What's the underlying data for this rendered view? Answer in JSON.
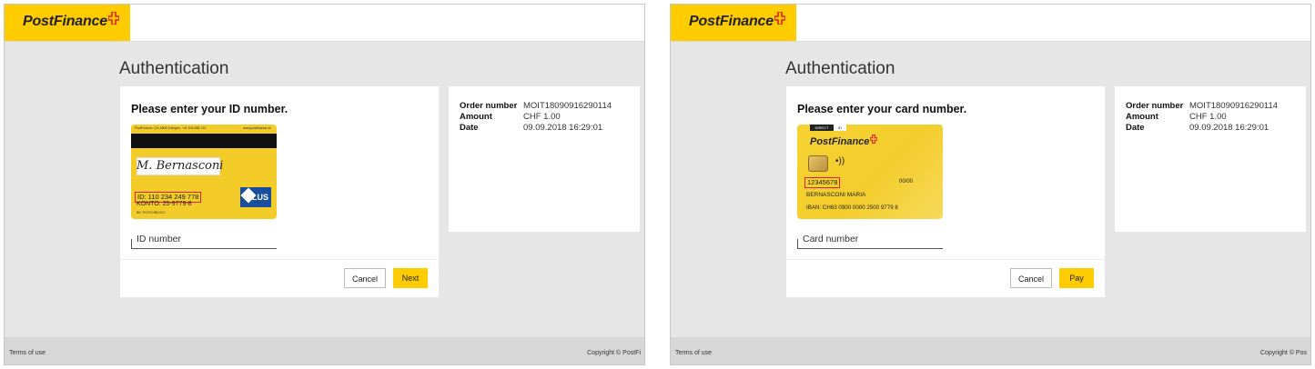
{
  "colors": {
    "brand_yellow": "#ffcc00",
    "highlight_red": "#e0201c",
    "background_gray": "#e6e6e6"
  },
  "panels": [
    {
      "brand": "PostFinance",
      "title": "Authentication",
      "prompt": "Please enter your ID number.",
      "card": {
        "header_left": "PostFinance, CH-4808 Zofingen, +41 848 888 710",
        "header_right": "www.postfinance.ch",
        "signature": "M. Bernasconi",
        "id_number": "ID: 110 234 249 778",
        "konto": "KONTO: 25-9779-8",
        "bic": "BIC POFICHBEXXX",
        "badge": "PLUS"
      },
      "field_label": "ID number",
      "cancel_label": "Cancel",
      "confirm_label": "Next",
      "order": {
        "order_number_label": "Order number",
        "order_number": "MOIT18090916290114",
        "amount_label": "Amount",
        "amount": "CHF  1.00",
        "date_label": "Date",
        "date": "09.09.2018 16:29:01"
      },
      "footer_left": "Terms of use",
      "footer_right": "Copyright © PostFi"
    },
    {
      "brand": "PostFinance",
      "title": "Authentication",
      "prompt": "Please enter your card number.",
      "card": {
        "tab1": "DIRECT",
        "tab2": "ID",
        "card_number": "12345678",
        "expiry": "00/00",
        "holder": "BERNASCONI MARIA",
        "iban": "IBAN: CH63 0900 0000 2500 9779 8"
      },
      "field_label": "Card number",
      "cancel_label": "Cancel",
      "confirm_label": "Pay",
      "order": {
        "order_number_label": "Order number",
        "order_number": "MOIT18090916290114",
        "amount_label": "Amount",
        "amount": "CHF  1.00",
        "date_label": "Date",
        "date": "09.09.2018 16:29:01"
      },
      "footer_left": "Terms of use",
      "footer_right": "Copyright © Pos"
    }
  ]
}
